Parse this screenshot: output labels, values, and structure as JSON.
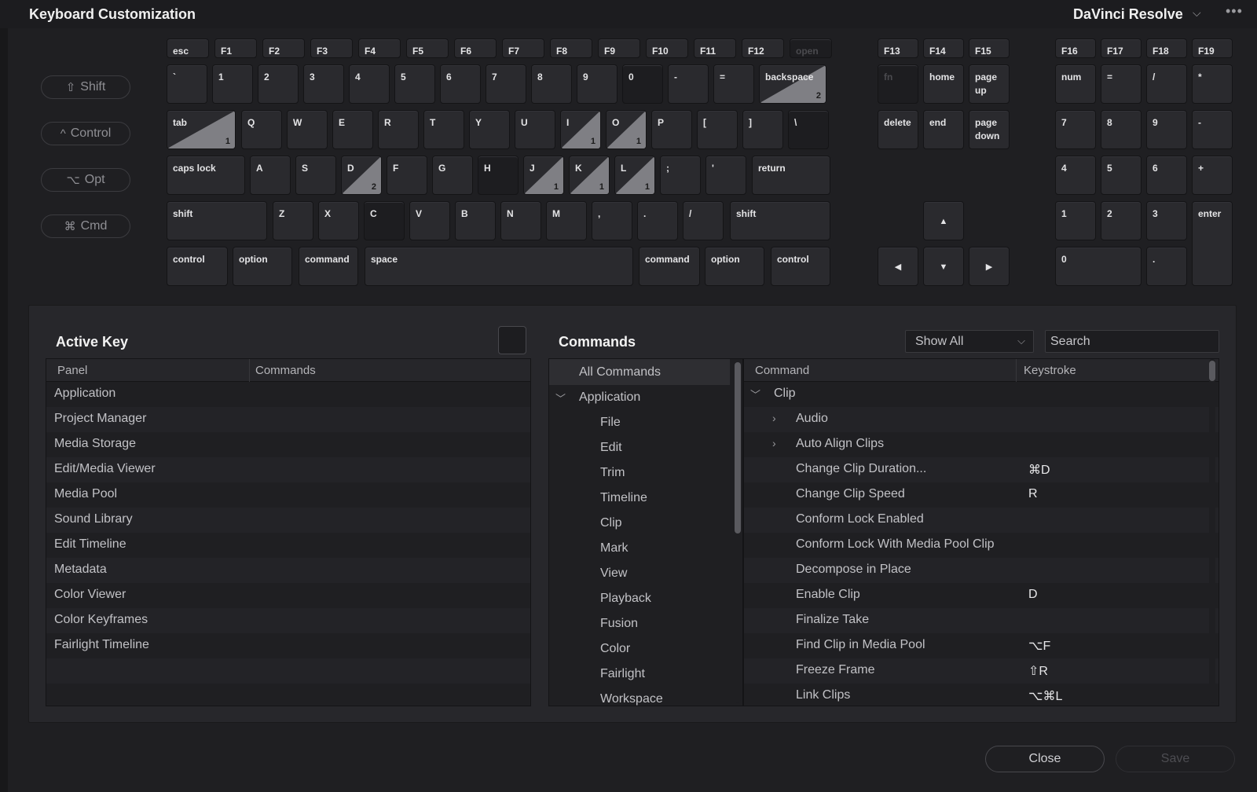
{
  "window": {
    "title": "Keyboard Customization",
    "workspace": "DaVinci Resolve",
    "more_icon": "ellipsis-icon"
  },
  "modifiers": [
    {
      "glyph": "⇧",
      "label": "Shift"
    },
    {
      "glyph": "^",
      "label": "Control"
    },
    {
      "glyph": "⌥",
      "label": "Opt"
    },
    {
      "glyph": "⌘",
      "label": "Cmd"
    }
  ],
  "keyboard": {
    "function_row": [
      "esc",
      "F1",
      "F2",
      "F3",
      "F4",
      "F5",
      "F6",
      "F7",
      "F8",
      "F9",
      "F10",
      "F11",
      "F12",
      "open"
    ],
    "number_row": [
      "`",
      "1",
      "2",
      "3",
      "4",
      "5",
      "6",
      "7",
      "8",
      "9",
      "0",
      "-",
      "=",
      "backspace"
    ],
    "top_row": [
      "tab",
      "Q",
      "W",
      "E",
      "R",
      "T",
      "Y",
      "U",
      "I",
      "O",
      "P",
      "[",
      "]",
      "\\"
    ],
    "home_row": [
      "caps lock",
      "A",
      "S",
      "D",
      "F",
      "G",
      "H",
      "J",
      "K",
      "L",
      ";",
      "'",
      "return"
    ],
    "bottom_row": [
      "shift",
      "Z",
      "X",
      "C",
      "V",
      "B",
      "N",
      "M",
      ",",
      ".",
      "/",
      "shift"
    ],
    "space_row": [
      "control",
      "option",
      "command",
      "space",
      "command",
      "option",
      "control"
    ],
    "assigned_counts": {
      "backspace": "2",
      "tab": "1",
      "I": "1",
      "O": "1",
      "D": "2",
      "J": "1",
      "K": "1",
      "L": "1"
    },
    "nav_fn": [
      "F13",
      "F14",
      "F15"
    ],
    "nav_row1": [
      "fn",
      "home",
      "page\nup"
    ],
    "nav_row2": [
      "delete",
      "end",
      "page\ndown"
    ],
    "arrows": [
      "▲",
      "◀",
      "▼",
      "▶"
    ],
    "num_fn": [
      "F16",
      "F17",
      "F18",
      "F19"
    ],
    "numpad": [
      "num",
      "=",
      "/",
      "*",
      "7",
      "8",
      "9",
      "-",
      "4",
      "5",
      "6",
      "+",
      "1",
      "2",
      "3",
      "enter",
      "0",
      "."
    ]
  },
  "active_key": {
    "title": "Active Key",
    "columns": [
      "Panel",
      "Commands"
    ],
    "rows": [
      "Application",
      "Project Manager",
      "Media Storage",
      "Edit/Media Viewer",
      "Media Pool",
      "Sound Library",
      "Edit Timeline",
      "Metadata",
      "Color Viewer",
      "Color Keyframes",
      "Fairlight Timeline"
    ]
  },
  "commands": {
    "title": "Commands",
    "filter": "Show All",
    "search_placeholder": "Search",
    "categories": {
      "all": "All Commands",
      "group": "Application",
      "items": [
        "File",
        "Edit",
        "Trim",
        "Timeline",
        "Clip",
        "Mark",
        "View",
        "Playback",
        "Fusion",
        "Color",
        "Fairlight",
        "Workspace"
      ]
    },
    "columns": [
      "Command",
      "Keystroke"
    ],
    "tree_root": "Clip",
    "groups": [
      "Audio",
      "Auto Align Clips"
    ],
    "rows": [
      {
        "command": "Change Clip Duration...",
        "keystroke": "⌘D"
      },
      {
        "command": "Change Clip Speed",
        "keystroke": "R"
      },
      {
        "command": "Conform Lock Enabled",
        "keystroke": ""
      },
      {
        "command": "Conform Lock With Media Pool Clip",
        "keystroke": ""
      },
      {
        "command": "Decompose in Place",
        "keystroke": ""
      },
      {
        "command": "Enable Clip",
        "keystroke": "D"
      },
      {
        "command": "Finalize Take",
        "keystroke": ""
      },
      {
        "command": "Find Clip in Media Pool",
        "keystroke": "⌥F"
      },
      {
        "command": "Freeze Frame",
        "keystroke": "⇧R"
      },
      {
        "command": "Link Clips",
        "keystroke": "⌥⌘L"
      }
    ]
  },
  "footer": {
    "close": "Close",
    "save": "Save"
  }
}
